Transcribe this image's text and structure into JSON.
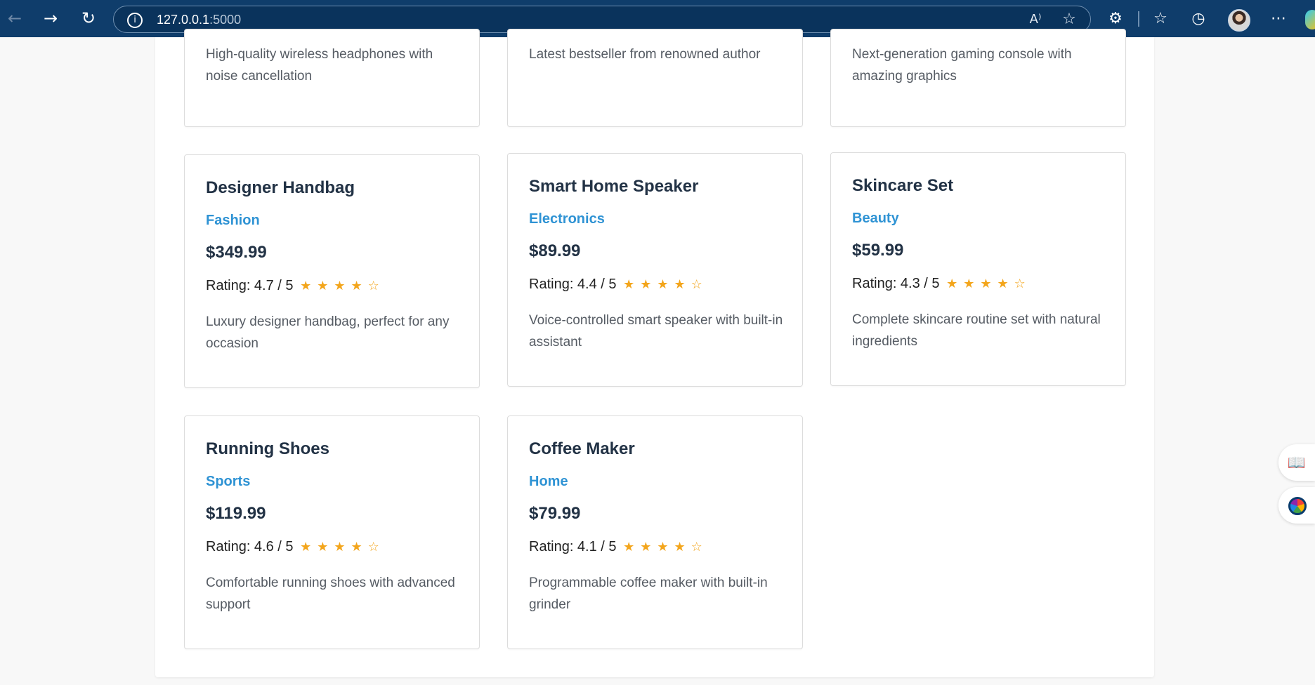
{
  "browser": {
    "url_host": "127.0.0.1",
    "url_port": ":5000",
    "icons": {
      "back": "←",
      "forward": "→",
      "refresh": "↻",
      "info": "i",
      "read_aloud": "A⁾",
      "favorite": "☆",
      "extensions": "⚙",
      "favorites": "☆",
      "history": "◷",
      "more": "⋯"
    }
  },
  "top_cards": [
    {
      "description": "High-quality wireless headphones with noise cancellation"
    },
    {
      "description": "Latest bestseller from renowned author"
    },
    {
      "description": "Next-generation gaming console with amazing graphics"
    }
  ],
  "products": [
    {
      "title": "Designer Handbag",
      "category": "Fashion",
      "price": "$349.99",
      "rating_text": "Rating: 4.7 / 5",
      "stars": "★★★★☆",
      "description": "Luxury designer handbag, perfect for any occasion"
    },
    {
      "title": "Smart Home Speaker",
      "category": "Electronics",
      "price": "$89.99",
      "rating_text": "Rating: 4.4 / 5",
      "stars": "★★★★☆",
      "description": "Voice-controlled smart speaker with built-in assistant"
    },
    {
      "title": "Skincare Set",
      "category": "Beauty",
      "price": "$59.99",
      "rating_text": "Rating: 4.3 / 5",
      "stars": "★★★★☆",
      "description": "Complete skincare routine set with natural ingredients"
    },
    {
      "title": "Running Shoes",
      "category": "Sports",
      "price": "$119.99",
      "rating_text": "Rating: 4.6 / 5",
      "stars": "★★★★☆",
      "description": "Comfortable running shoes with advanced support"
    },
    {
      "title": "Coffee Maker",
      "category": "Home",
      "price": "$79.99",
      "rating_text": "Rating: 4.1 / 5",
      "stars": "★★★★☆",
      "description": "Programmable coffee maker with built-in grinder"
    }
  ],
  "side_panel": {
    "reading_icon": "📖"
  },
  "colors": {
    "toolbar": "#0f3d6b",
    "category_blue": "#2f93d4",
    "star_orange": "#f3a51b",
    "title_dark": "#223245"
  }
}
